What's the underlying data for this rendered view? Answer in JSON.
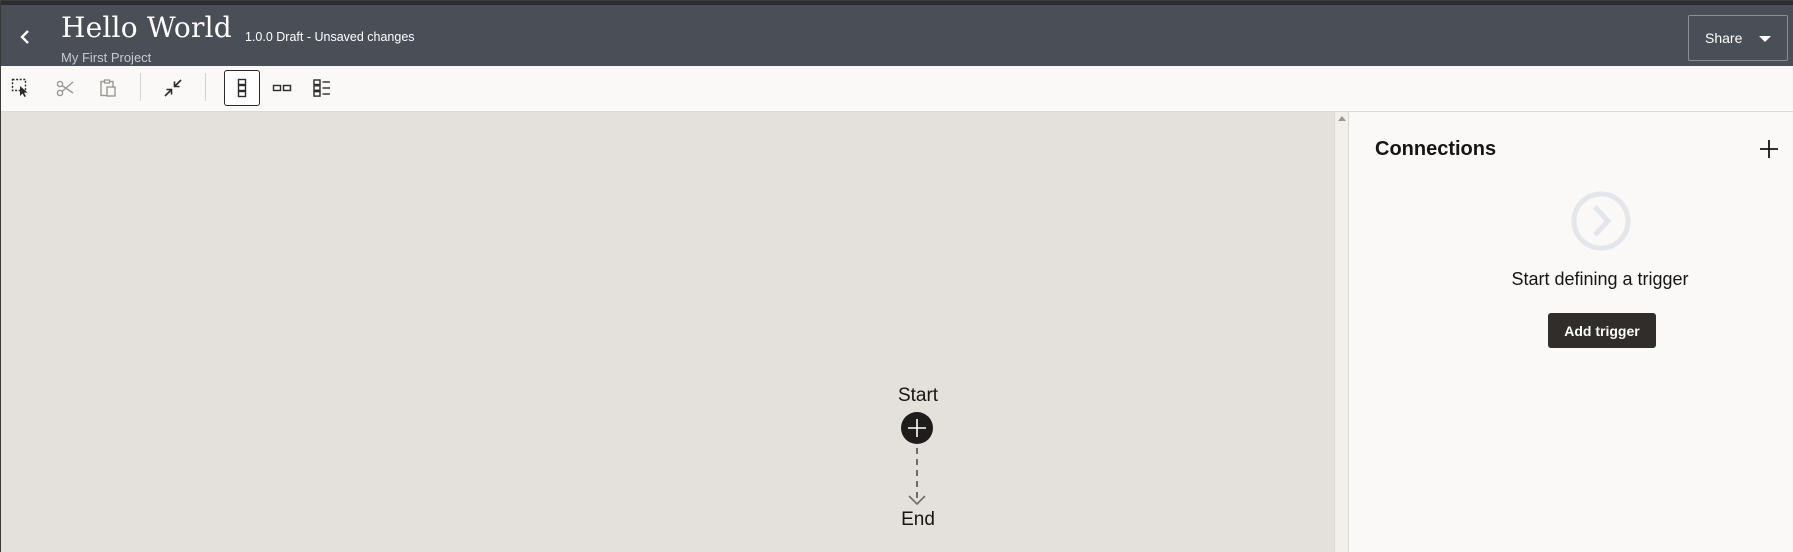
{
  "header": {
    "title": "Hello World",
    "version_status": "1.0.0 Draft - Unsaved changes",
    "project": "My First Project",
    "share_label": "Share",
    "background": "#4a4e56"
  },
  "toolbar": {
    "buttons": [
      {
        "name": "select",
        "icon": "marquee-select-icon",
        "enabled": true
      },
      {
        "name": "cut",
        "icon": "scissors-icon",
        "enabled": false
      },
      {
        "name": "paste",
        "icon": "clipboard-icon",
        "enabled": false
      },
      {
        "name": "collapse",
        "icon": "collapse-arrows-icon",
        "enabled": true
      },
      {
        "name": "vertical-layout",
        "icon": "vertical-layout-icon",
        "selected": true
      },
      {
        "name": "horizontal-layout",
        "icon": "horizontal-layout-icon",
        "selected": false
      },
      {
        "name": "list-layout",
        "icon": "list-layout-icon",
        "selected": false
      }
    ]
  },
  "canvas": {
    "start_label": "Start",
    "end_label": "End",
    "background": "#e4e1dc"
  },
  "panel": {
    "title": "Connections",
    "empty_message": "Start defining a trigger",
    "add_trigger_label": "Add trigger",
    "button_color": "#312d2a"
  }
}
